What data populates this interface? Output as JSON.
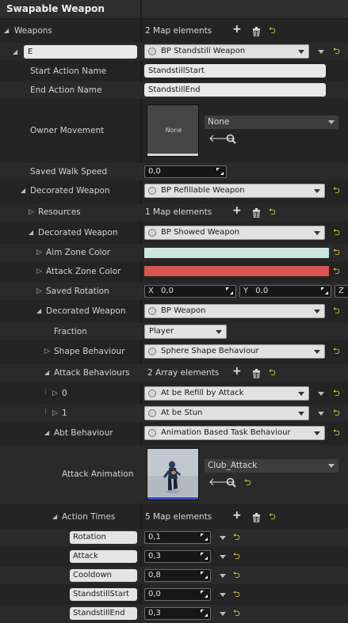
{
  "panel": {
    "title": "Swapable Weapon"
  },
  "weapons": {
    "label": "Weapons",
    "count": "2 Map elements",
    "key": "E",
    "value": "BP Standstill Weapon",
    "start_action": {
      "label": "Start Action Name",
      "value": "StandstillStart"
    },
    "end_action": {
      "label": "End Action Name",
      "value": "StandstillEnd"
    },
    "owner_movement": {
      "label": "Owner Movement",
      "thumbnail_text": "None",
      "value": "None"
    },
    "saved_walk_speed": {
      "label": "Saved Walk Speed",
      "value": "0,0"
    }
  },
  "decorated_1": {
    "label": "Decorated Weapon",
    "value": "BP Refillable Weapon",
    "resources": {
      "label": "Resources",
      "count": "1 Map elements"
    }
  },
  "decorated_2": {
    "label": "Decorated Weapon",
    "value": "BP Showed Weapon",
    "aim_zone_color": {
      "label": "Aim Zone Color",
      "color": "#cfe6e0"
    },
    "attack_zone_color": {
      "label": "Attack Zone Color",
      "color": "#d9554f"
    },
    "saved_rotation": {
      "label": "Saved Rotation",
      "x_label": "X",
      "x": "0,0",
      "y_label": "Y",
      "y": "0,0",
      "z_label": "Z"
    }
  },
  "decorated_3": {
    "label": "Decorated Weapon",
    "value": "BP Weapon",
    "fraction": {
      "label": "Fraction",
      "value": "Player"
    },
    "shape_behaviour": {
      "label": "Shape Behaviour",
      "value": "Sphere Shape Behaviour"
    },
    "attack_behaviours": {
      "label": "Attack Behaviours",
      "count": "2 Array elements",
      "items": [
        {
          "index": "0",
          "value": "At be Refill by Attack"
        },
        {
          "index": "1",
          "value": "At be Stun"
        }
      ]
    },
    "abt_behaviour": {
      "label": "Abt Behaviour",
      "value": "Animation Based Task Behaviour"
    },
    "attack_animation": {
      "label": "Attack Animation",
      "value": "Club_Attack"
    },
    "action_times": {
      "label": "Action Times",
      "count": "5 Map elements",
      "entries": [
        {
          "key": "Rotation",
          "value": "0,1"
        },
        {
          "key": "Attack",
          "value": "0,3"
        },
        {
          "key": "Cooldown",
          "value": "0,8"
        },
        {
          "key": "StandstillStart",
          "value": "0,0"
        },
        {
          "key": "StandstillEnd",
          "value": "0,3"
        }
      ]
    }
  },
  "colors": {
    "background": "#242424",
    "header": "#2f2f2f",
    "reset_yellow": "#e6d43a",
    "thumb_bar_blue": "#3b4fd0"
  },
  "icons": {
    "add": "plus-icon",
    "delete": "trash-icon",
    "reset": "reset-to-default-icon",
    "browse": "browse-arrow-icon",
    "find": "magnifier-icon",
    "expand": "triangle-icon"
  }
}
